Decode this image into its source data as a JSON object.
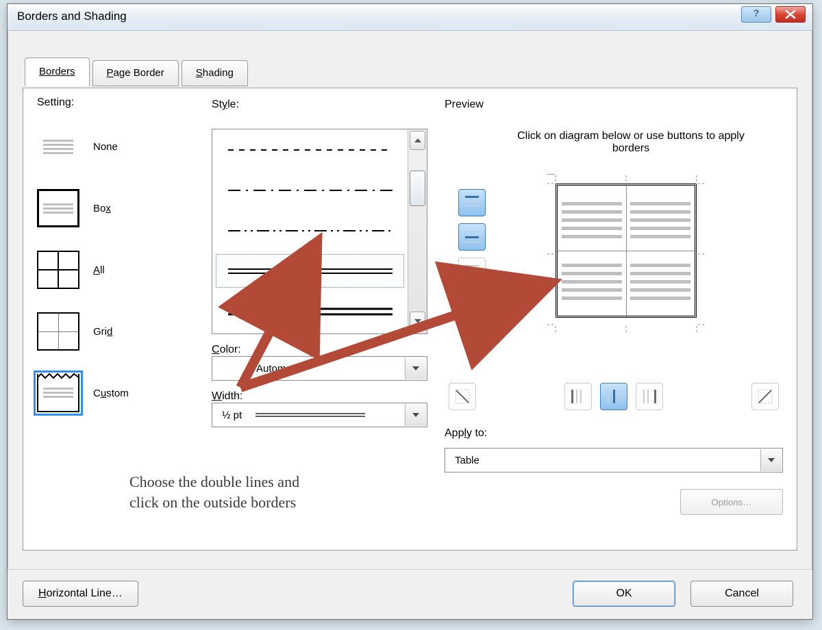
{
  "titlebar": {
    "title": "Borders and Shading"
  },
  "tabs": {
    "borders": "Borders",
    "page_border": "Page Border",
    "shading": "Shading",
    "active": "borders"
  },
  "settings": {
    "label": "Setting:",
    "items": [
      {
        "key": "none",
        "label": "None"
      },
      {
        "key": "box",
        "label": "Box"
      },
      {
        "key": "all",
        "label": "All"
      },
      {
        "key": "grid",
        "label": "Grid"
      },
      {
        "key": "custom",
        "label": "Custom"
      }
    ],
    "selected": "custom"
  },
  "style": {
    "label": "Style:",
    "selected_index": 3,
    "options": [
      "dashed",
      "dash-dot",
      "dash-dot-dot",
      "double-thin",
      "double-thick"
    ]
  },
  "color": {
    "label": "Color:",
    "value": "Automatic"
  },
  "width": {
    "label": "Width:",
    "value": "½ pt"
  },
  "preview": {
    "label": "Preview",
    "hint": "Click on diagram below or use buttons to apply borders",
    "side_toggles": [
      "border-top",
      "border-middle-h",
      "border-bottom"
    ],
    "bottom_toggles": [
      "diag-down",
      "border-left",
      "border-middle-v",
      "border-right",
      "diag-up"
    ],
    "side_selected": [
      "border-top",
      "border-middle-h"
    ],
    "bottom_selected": [
      "border-middle-v"
    ]
  },
  "apply_to": {
    "label": "Apply to:",
    "value": "Table"
  },
  "buttons": {
    "options": "Options…",
    "horizontal_line": "Horizontal Line…",
    "ok": "OK",
    "cancel": "Cancel"
  },
  "annotation": "Choose the double lines and\nclick on the outside borders"
}
